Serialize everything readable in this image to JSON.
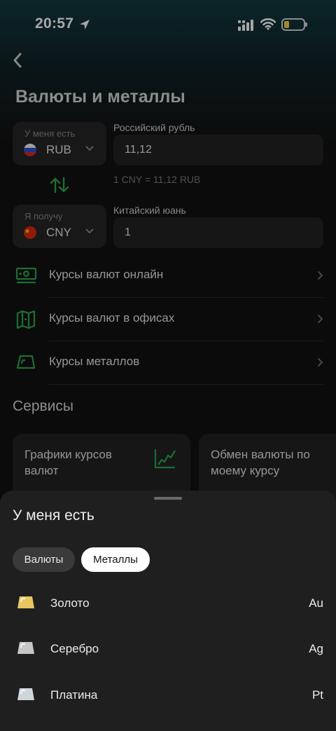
{
  "status_bar": {
    "time": "20:57"
  },
  "header": {
    "title": "Валюты и металлы"
  },
  "converter": {
    "from": {
      "label": "У меня есть",
      "code": "RUB",
      "currency_name": "Российский рубль",
      "amount": "11,12"
    },
    "rate_hint": "1 CNY = 11,12 RUB",
    "to": {
      "label": "Я получу",
      "code": "CNY",
      "currency_name": "Китайский юань",
      "amount": "1"
    }
  },
  "menu": {
    "items": [
      {
        "label": "Курсы валют онлайн",
        "icon": "banknote-icon"
      },
      {
        "label": "Курсы валют в офисах",
        "icon": "map-icon"
      },
      {
        "label": "Курсы металлов",
        "icon": "ingot-icon"
      }
    ]
  },
  "services": {
    "title": "Сервисы",
    "cards": [
      {
        "label": "Графики курсов валют",
        "icon": "chart-line-icon"
      },
      {
        "label": "Обмен валюты по моему курсу"
      }
    ]
  },
  "sheet": {
    "title": "У меня есть",
    "tabs": [
      {
        "label": "Валюты",
        "selected": false
      },
      {
        "label": "Металлы",
        "selected": true
      }
    ],
    "metals": [
      {
        "name": "Золото",
        "symbol": "Au",
        "color": "#e8c660"
      },
      {
        "name": "Серебро",
        "symbol": "Ag",
        "color": "#c6c6c6"
      },
      {
        "name": "Платина",
        "symbol": "Pt",
        "color": "#cfd6da"
      }
    ]
  },
  "colors": {
    "accent": "#2fa84f",
    "background": "#121212",
    "sheet": "#1f1f1f"
  }
}
